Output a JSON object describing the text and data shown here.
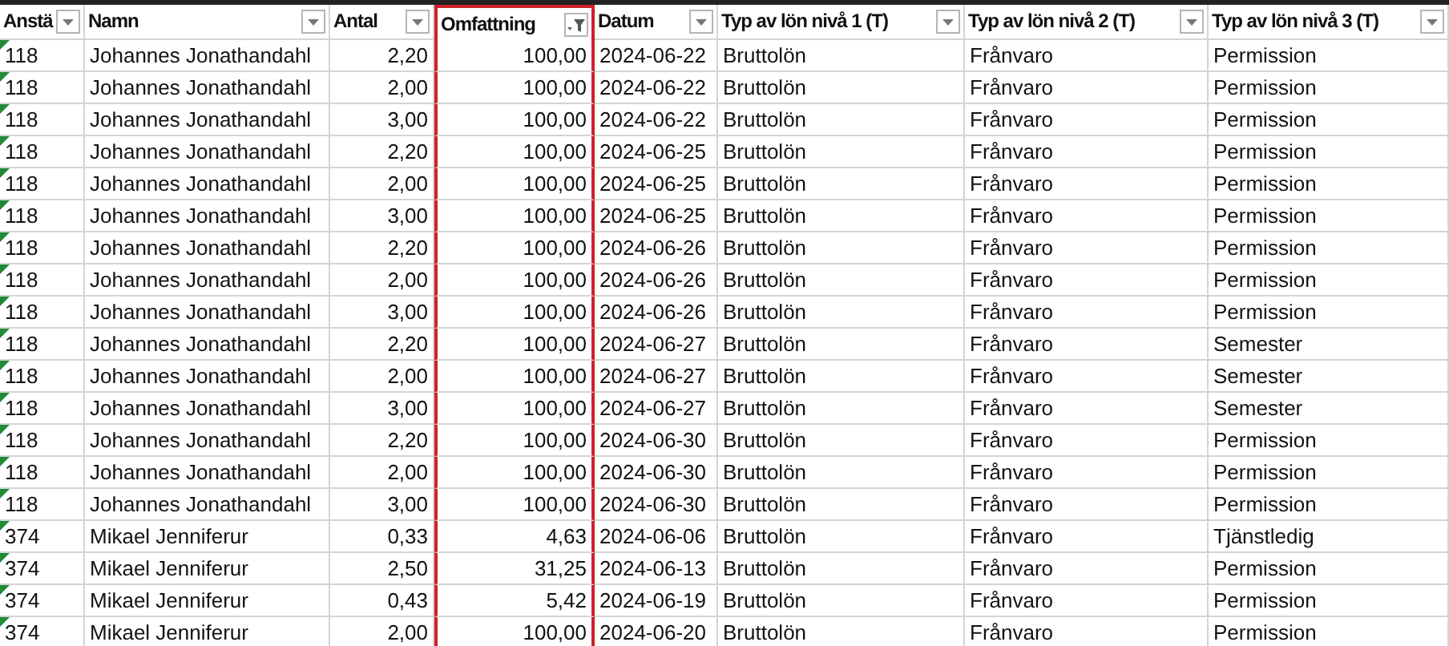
{
  "columns": [
    {
      "label": "Anstä",
      "kind": "text",
      "filtered": false,
      "highlighted": false
    },
    {
      "label": "Namn",
      "kind": "text",
      "filtered": false,
      "highlighted": false
    },
    {
      "label": "Antal",
      "kind": "number",
      "filtered": false,
      "highlighted": false
    },
    {
      "label": "Omfattning",
      "kind": "number",
      "filtered": true,
      "highlighted": true
    },
    {
      "label": "Datum",
      "kind": "text",
      "filtered": false,
      "highlighted": false
    },
    {
      "label": "Typ av lön nivå 1 (T)",
      "kind": "text",
      "filtered": false,
      "highlighted": false
    },
    {
      "label": "Typ av lön nivå 2 (T)",
      "kind": "text",
      "filtered": false,
      "highlighted": false
    },
    {
      "label": "Typ av lön nivå 3 (T)",
      "kind": "text",
      "filtered": false,
      "highlighted": false
    }
  ],
  "rows": [
    {
      "flagged": true,
      "cells": [
        "118",
        "Johannes Jonathandahl",
        "2,20",
        "100,00",
        "2024-06-22",
        "Bruttolön",
        "Frånvaro",
        "Permission"
      ]
    },
    {
      "flagged": true,
      "cells": [
        "118",
        "Johannes Jonathandahl",
        "2,00",
        "100,00",
        "2024-06-22",
        "Bruttolön",
        "Frånvaro",
        "Permission"
      ]
    },
    {
      "flagged": true,
      "cells": [
        "118",
        "Johannes Jonathandahl",
        "3,00",
        "100,00",
        "2024-06-22",
        "Bruttolön",
        "Frånvaro",
        "Permission"
      ]
    },
    {
      "flagged": true,
      "cells": [
        "118",
        "Johannes Jonathandahl",
        "2,20",
        "100,00",
        "2024-06-25",
        "Bruttolön",
        "Frånvaro",
        "Permission"
      ]
    },
    {
      "flagged": true,
      "cells": [
        "118",
        "Johannes Jonathandahl",
        "2,00",
        "100,00",
        "2024-06-25",
        "Bruttolön",
        "Frånvaro",
        "Permission"
      ]
    },
    {
      "flagged": true,
      "cells": [
        "118",
        "Johannes Jonathandahl",
        "3,00",
        "100,00",
        "2024-06-25",
        "Bruttolön",
        "Frånvaro",
        "Permission"
      ]
    },
    {
      "flagged": true,
      "cells": [
        "118",
        "Johannes Jonathandahl",
        "2,20",
        "100,00",
        "2024-06-26",
        "Bruttolön",
        "Frånvaro",
        "Permission"
      ]
    },
    {
      "flagged": true,
      "cells": [
        "118",
        "Johannes Jonathandahl",
        "2,00",
        "100,00",
        "2024-06-26",
        "Bruttolön",
        "Frånvaro",
        "Permission"
      ]
    },
    {
      "flagged": true,
      "cells": [
        "118",
        "Johannes Jonathandahl",
        "3,00",
        "100,00",
        "2024-06-26",
        "Bruttolön",
        "Frånvaro",
        "Permission"
      ]
    },
    {
      "flagged": true,
      "cells": [
        "118",
        "Johannes Jonathandahl",
        "2,20",
        "100,00",
        "2024-06-27",
        "Bruttolön",
        "Frånvaro",
        "Semester"
      ]
    },
    {
      "flagged": true,
      "cells": [
        "118",
        "Johannes Jonathandahl",
        "2,00",
        "100,00",
        "2024-06-27",
        "Bruttolön",
        "Frånvaro",
        "Semester"
      ]
    },
    {
      "flagged": true,
      "cells": [
        "118",
        "Johannes Jonathandahl",
        "3,00",
        "100,00",
        "2024-06-27",
        "Bruttolön",
        "Frånvaro",
        "Semester"
      ]
    },
    {
      "flagged": true,
      "cells": [
        "118",
        "Johannes Jonathandahl",
        "2,20",
        "100,00",
        "2024-06-30",
        "Bruttolön",
        "Frånvaro",
        "Permission"
      ]
    },
    {
      "flagged": true,
      "cells": [
        "118",
        "Johannes Jonathandahl",
        "2,00",
        "100,00",
        "2024-06-30",
        "Bruttolön",
        "Frånvaro",
        "Permission"
      ]
    },
    {
      "flagged": true,
      "cells": [
        "118",
        "Johannes Jonathandahl",
        "3,00",
        "100,00",
        "2024-06-30",
        "Bruttolön",
        "Frånvaro",
        "Permission"
      ]
    },
    {
      "flagged": true,
      "cells": [
        "374",
        "Mikael Jenniferur",
        "0,33",
        "4,63",
        "2024-06-06",
        "Bruttolön",
        "Frånvaro",
        "Tjänstledig"
      ]
    },
    {
      "flagged": true,
      "cells": [
        "374",
        "Mikael Jenniferur",
        "2,50",
        "31,25",
        "2024-06-13",
        "Bruttolön",
        "Frånvaro",
        "Permission"
      ]
    },
    {
      "flagged": true,
      "cells": [
        "374",
        "Mikael Jenniferur",
        "0,43",
        "5,42",
        "2024-06-19",
        "Bruttolön",
        "Frånvaro",
        "Permission"
      ]
    },
    {
      "flagged": true,
      "cells": [
        "374",
        "Mikael Jenniferur",
        "2,00",
        "100,00",
        "2024-06-20",
        "Bruttolön",
        "Frånvaro",
        "Permission"
      ]
    }
  ]
}
